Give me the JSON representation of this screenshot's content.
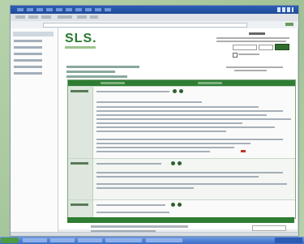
{
  "window": {
    "title": "",
    "address": ""
  },
  "site": {
    "logo": "SLS.",
    "brand_color": "#2e7d32",
    "accent_color": "#6dbb51"
  },
  "sidebar": {
    "items": [
      "",
      "",
      "",
      "",
      "",
      ""
    ]
  },
  "table": {
    "header_color": "#2e7d32",
    "rows": [
      {
        "label": ""
      },
      {
        "label": ""
      },
      {
        "label": ""
      }
    ]
  },
  "icons": [
    "search-icon",
    "arrow-icon",
    "user-icon"
  ]
}
